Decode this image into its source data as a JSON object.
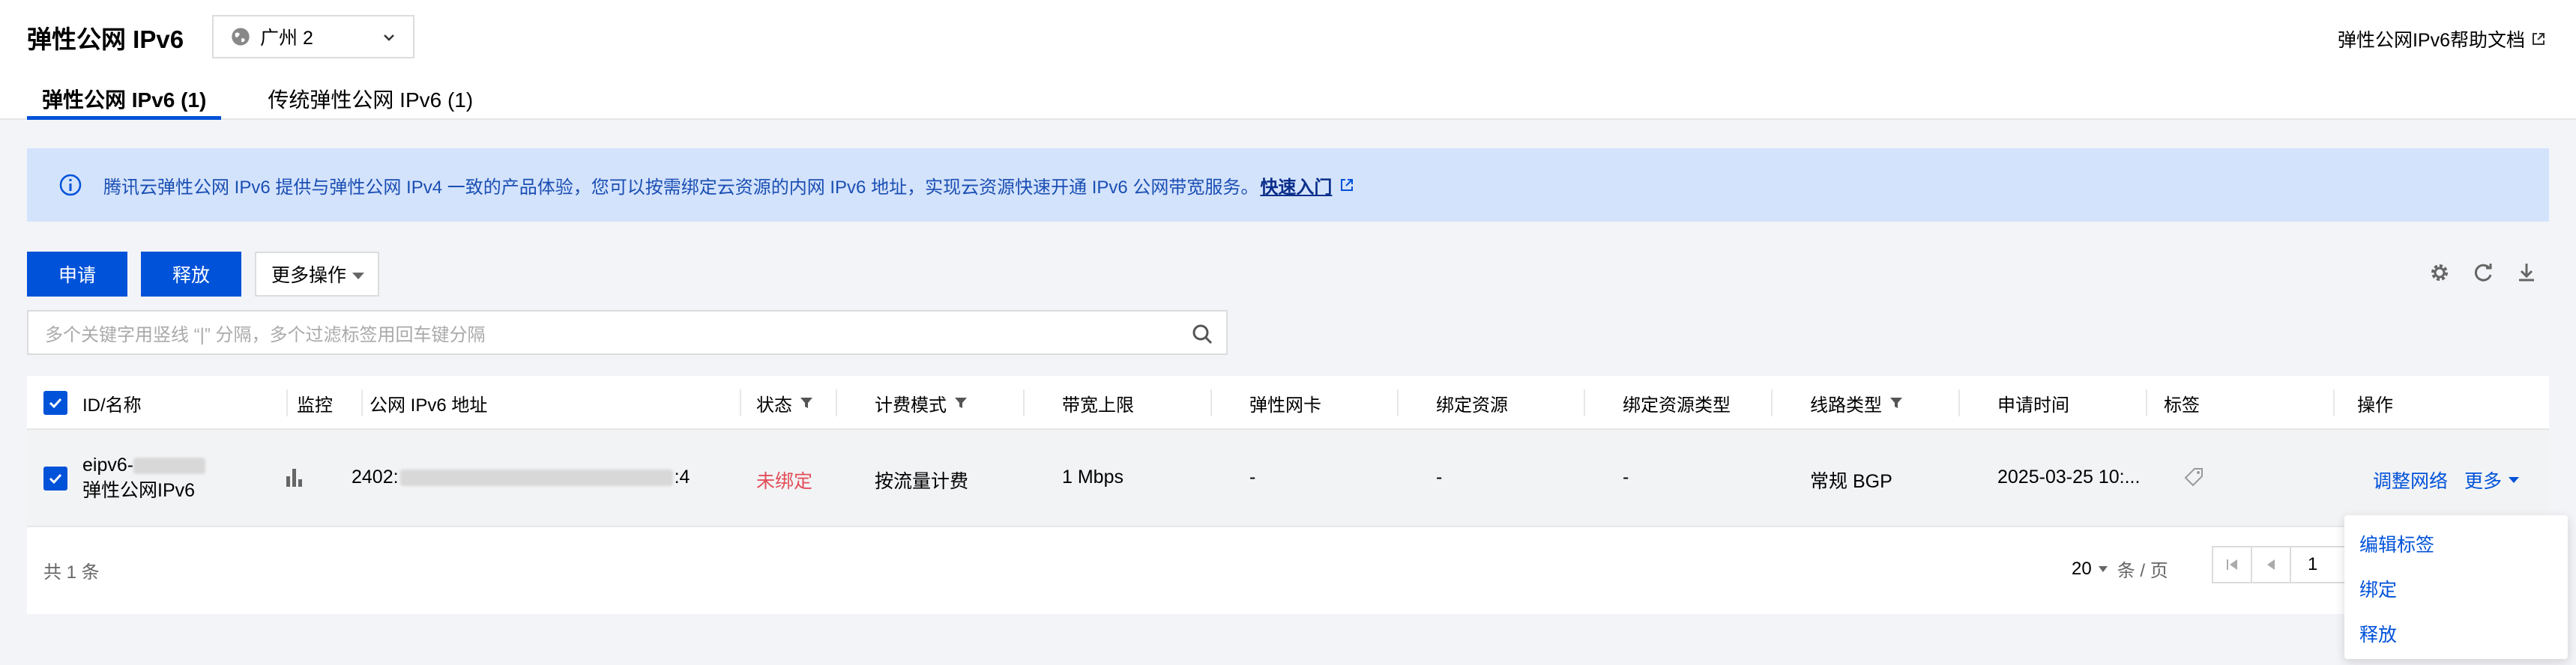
{
  "header": {
    "title": "弹性公网 IPv6",
    "region": "广州 2",
    "help_link": "弹性公网IPv6帮助文档"
  },
  "tabs": [
    {
      "label": "弹性公网 IPv6 (1)",
      "active": true
    },
    {
      "label": "传统弹性公网 IPv6 (1)",
      "active": false
    }
  ],
  "info_bar": {
    "text": "腾讯云弹性公网 IPv6 提供与弹性公网 IPv4 一致的产品体验，您可以按需绑定云资源的内网 IPv6 地址，实现云资源快速开通 IPv6 公网带宽服务。",
    "link": "快速入门"
  },
  "toolbar": {
    "apply": "申请",
    "release": "释放",
    "more": "更多操作"
  },
  "search": {
    "placeholder": "多个关键字用竖线 “|” 分隔，多个过滤标签用回车键分隔"
  },
  "table": {
    "columns": [
      "ID/名称",
      "监控",
      "公网 IPv6 地址",
      "状态",
      "计费模式",
      "带宽上限",
      "弹性网卡",
      "绑定资源",
      "绑定资源类型",
      "线路类型",
      "申请时间",
      "标签",
      "操作"
    ],
    "rows": [
      {
        "id": "eipv6-",
        "name": "弹性公网IPv6",
        "ipv6_prefix": "2402:",
        "ipv6_suffix": ":4",
        "status": "未绑定",
        "billing": "按流量计费",
        "bandwidth": "1 Mbps",
        "eni": "-",
        "bound_resource": "-",
        "bound_type": "-",
        "line_type": "常规 BGP",
        "apply_time": "2025-03-25 10:...",
        "op_adjust": "调整网络",
        "op_more": "更多"
      }
    ],
    "total": "共 1 条",
    "page_size": "20",
    "page_size_unit": "条 / 页",
    "page": "1"
  },
  "dropdown": {
    "items": [
      "编辑标签",
      "绑定",
      "释放"
    ]
  },
  "colors": {
    "primary": "#0052d9",
    "info_bg": "#d4e3fc",
    "status_red": "#e34d59"
  }
}
